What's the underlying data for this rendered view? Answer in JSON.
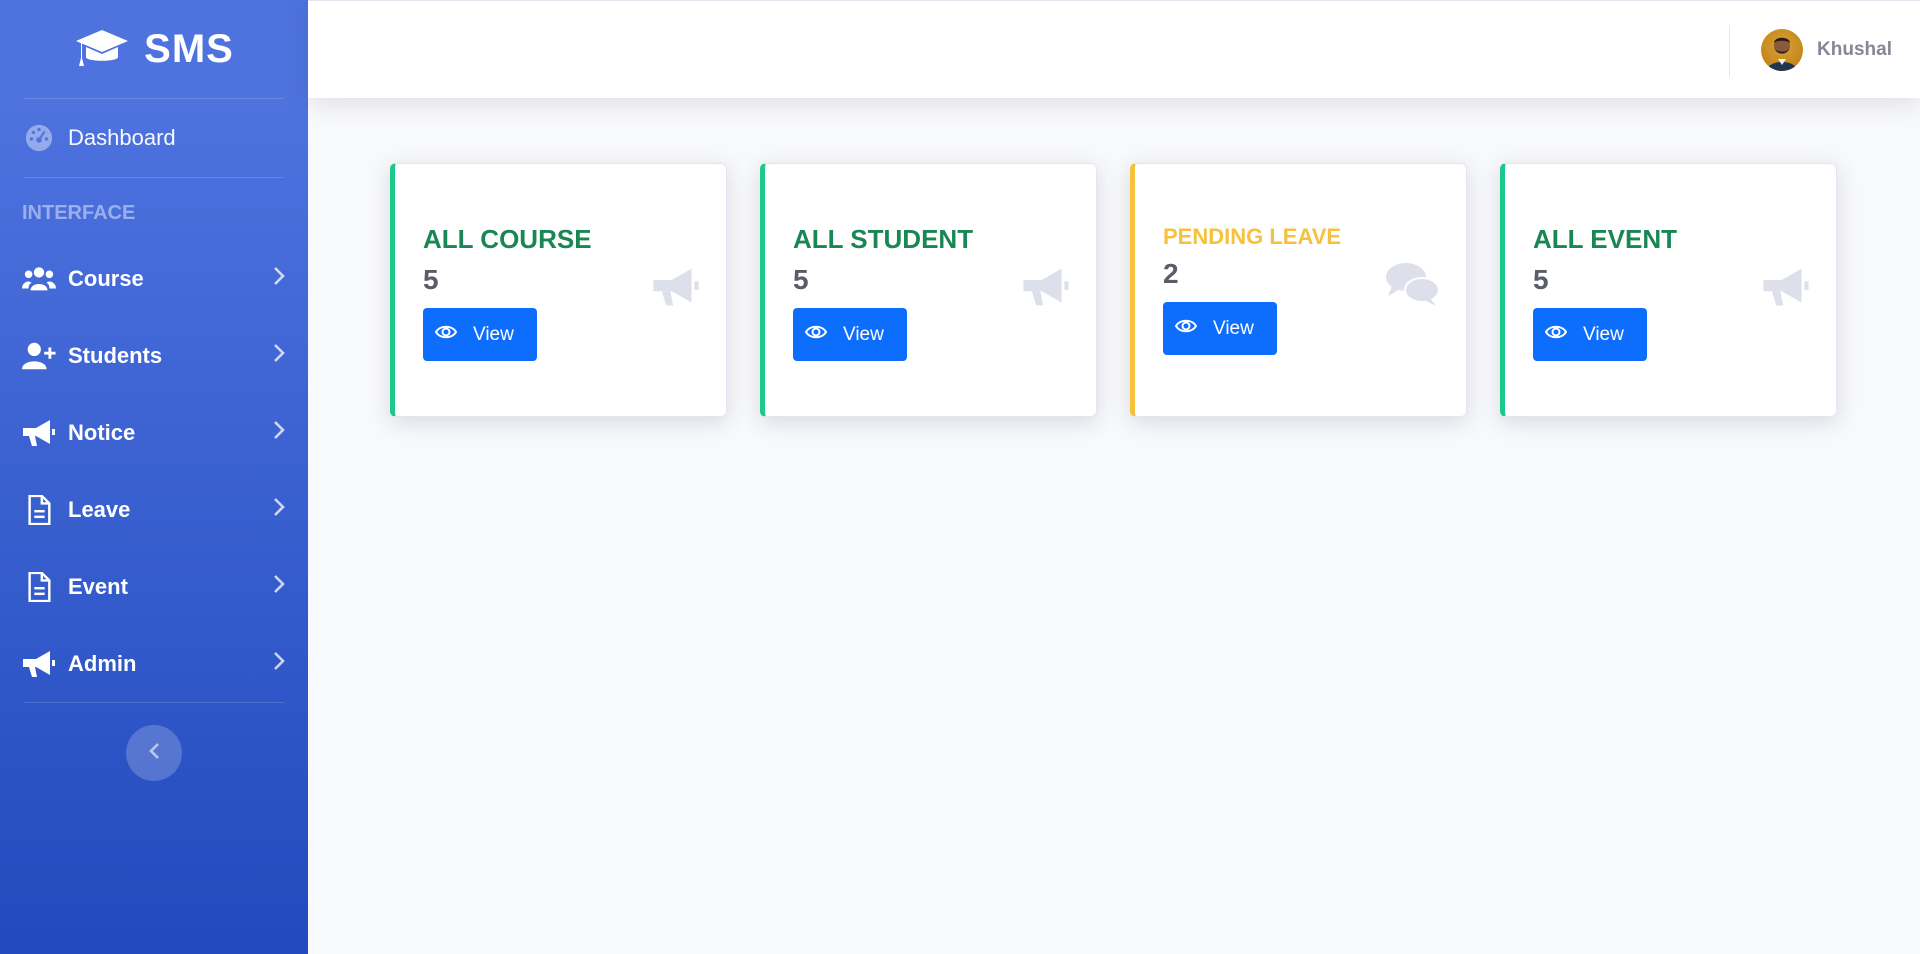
{
  "brand": {
    "name": "SMS",
    "icon": "graduation-cap-icon"
  },
  "sidebar": {
    "dashboard": {
      "label": "Dashboard",
      "icon": "tachometer-icon"
    },
    "heading": "Interface",
    "items": [
      {
        "label": "Course",
        "icon": "users-icon"
      },
      {
        "label": "Students",
        "icon": "user-plus-icon"
      },
      {
        "label": "Notice",
        "icon": "bullhorn-icon"
      },
      {
        "label": "Leave",
        "icon": "file-icon"
      },
      {
        "label": "Event",
        "icon": "file-icon"
      },
      {
        "label": "Admin",
        "icon": "bullhorn-icon"
      }
    ],
    "toggle_icon": "chevron-left-icon"
  },
  "topbar": {
    "user_name": "Khushal",
    "avatar": "user-avatar"
  },
  "cards": [
    {
      "title": "ALL COURSE",
      "value": "5",
      "button": "View",
      "icon": "bullhorn-icon",
      "accent": "#1cc88a"
    },
    {
      "title": "ALL STUDENT",
      "value": "5",
      "button": "View",
      "icon": "bullhorn-icon",
      "accent": "#1cc88a"
    },
    {
      "title": "PENDING LEAVE",
      "value": "2",
      "button": "View",
      "icon": "comments-icon",
      "accent": "#f6c23e"
    },
    {
      "title": "ALL EVENT",
      "value": "5",
      "button": "View",
      "icon": "bullhorn-icon",
      "accent": "#1cc88a"
    }
  ],
  "colors": {
    "sidebar_top": "#4e73df",
    "sidebar_bottom": "#224abe",
    "primary_button": "#0d6efd",
    "title_green": "#198754",
    "title_yellow": "#f6c23e",
    "background": "#f8f9fc"
  }
}
